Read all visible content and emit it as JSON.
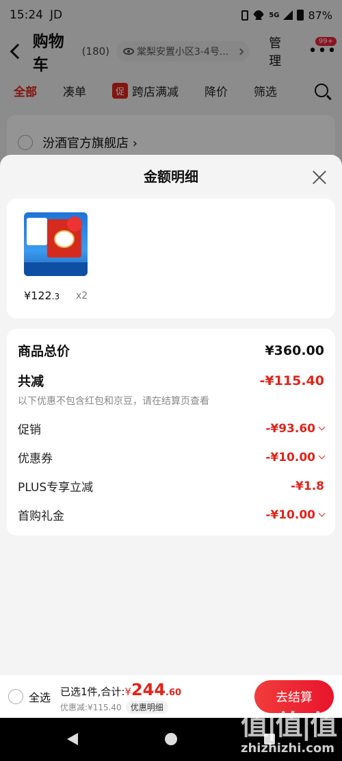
{
  "status_bar": {
    "time": "15:24",
    "carrier": "JD",
    "network": "5G",
    "battery": "87%"
  },
  "header": {
    "title": "购物车",
    "count": "(180)",
    "address": "棠梨安置小区3-4号...",
    "manage": "管理",
    "badge": "99+"
  },
  "tabs": [
    {
      "label": "全部"
    },
    {
      "label": "凑单"
    },
    {
      "label": "跨店满减",
      "tag": "促"
    },
    {
      "label": "降价"
    },
    {
      "label": "筛选"
    }
  ],
  "store": {
    "name": "汾酒官方旗舰店 ›"
  },
  "sheet": {
    "title": "金额明细",
    "product": {
      "price": "¥122",
      "price_decimal": ".3",
      "quantity": "x2"
    },
    "rows": {
      "total_label": "商品总价",
      "total_value": "¥360.00",
      "reduce_label": "共减",
      "reduce_value": "-¥115.40",
      "note": "以下优惠不包含红包和京豆，请在结算页查看",
      "promo_label": "促销",
      "promo_value": "-¥93.60",
      "coupon_label": "优惠券",
      "coupon_value": "-¥10.00",
      "plus_label": "PLUS专享立减",
      "plus_value": "-¥1.8",
      "gift_label": "首购礼金",
      "gift_value": "-¥10.00"
    }
  },
  "bottom": {
    "select_all": "全选",
    "selected_prefix": "已选1件,合计:",
    "currency": "¥",
    "total_int": "244",
    "total_dec": ".60",
    "discount": "优惠减:¥115.40",
    "detail_button": "优惠明细",
    "checkout": "去结算"
  },
  "watermark": {
    "logo": "值|值|值",
    "site": "zhizhizhi.com"
  },
  "colors": {
    "accent": "#e2231a",
    "checkout": "#f23c3c"
  }
}
